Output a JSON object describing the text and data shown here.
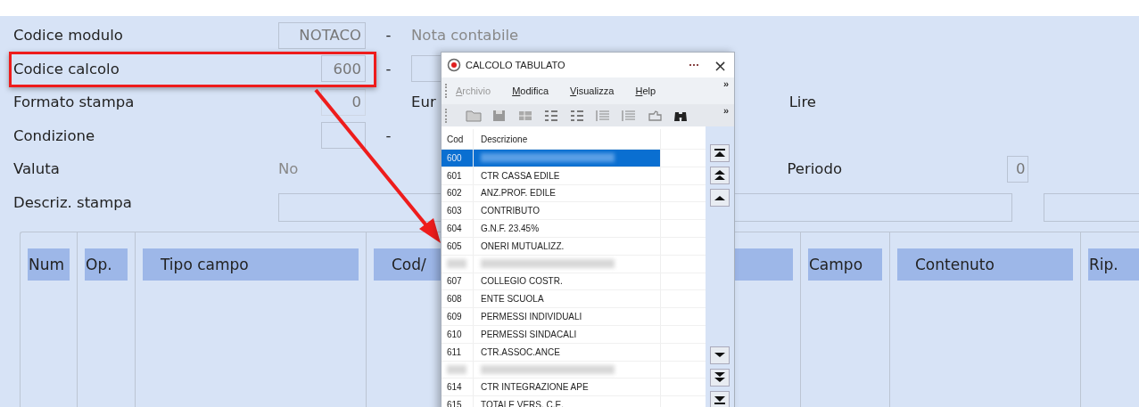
{
  "form": {
    "rows": [
      {
        "kind": "code",
        "label": "Codice modulo",
        "value": "NOTACO",
        "separator": "-",
        "description": "Nota contabile"
      },
      {
        "kind": "short",
        "label": "Codice calcolo",
        "value": "600",
        "separator": "-",
        "description_box": true
      },
      {
        "kind": "currency",
        "label": "Formato stampa",
        "value": "0",
        "left_text": "Eur",
        "right_text": "Lire"
      },
      {
        "kind": "short",
        "label": "Condizione",
        "value": "",
        "separator": "-",
        "description_box": false
      },
      {
        "kind": "plain",
        "label": "Valuta",
        "value": "No",
        "right_label": "Periodo",
        "right_value": "0"
      },
      {
        "kind": "long",
        "label": "Descriz. stampa"
      }
    ]
  },
  "table": {
    "columns": [
      "Num",
      "Op.",
      "Tipo campo",
      "Cod/",
      "Campo",
      "Contenuto",
      "Rip."
    ]
  },
  "popup": {
    "title": "CALCOLO TABULATO",
    "close": "×",
    "menu": [
      {
        "label": "Archivio",
        "disabled": true
      },
      {
        "label": "Modifica",
        "disabled": false
      },
      {
        "label": "Visualizza",
        "disabled": false
      },
      {
        "label": "Help",
        "disabled": false
      }
    ],
    "overflow": "»",
    "toolbar_overflow": "»",
    "columns": [
      "Cod",
      "Descrizione"
    ],
    "rows": [
      {
        "code": "600",
        "selected": true
      },
      {
        "code": "601",
        "description": "CTR CASSA EDILE",
        "selected": false
      },
      {
        "code": "602",
        "description": "ANZ.PROF. EDILE",
        "selected": false
      },
      {
        "code": "603",
        "description": "CONTRIBUTO",
        "selected": false
      },
      {
        "code": "604",
        "description": "G.N.F. 23.45%",
        "selected": false
      },
      {
        "code": "605",
        "description": "ONERI MUTUALIZZ.",
        "selected": false
      },
      {
        "selected": false
      },
      {
        "code": "607",
        "description": "COLLEGIO COSTR.",
        "selected": false
      },
      {
        "code": "608",
        "description": "ENTE SCUOLA",
        "selected": false
      },
      {
        "code": "609",
        "description": "PERMESSI INDIVIDUALI",
        "selected": false
      },
      {
        "code": "610",
        "description": "PERMESSI SINDACALI",
        "selected": false
      },
      {
        "code": "611",
        "description": "CTR.ASSOC.ANCE",
        "selected": false
      },
      {
        "selected": false
      },
      {
        "code": "614",
        "description": "CTR INTEGRAZIONE APE",
        "selected": false
      },
      {
        "code": "615",
        "description": "TOTALE VERS. C.E.",
        "selected": false
      }
    ]
  }
}
